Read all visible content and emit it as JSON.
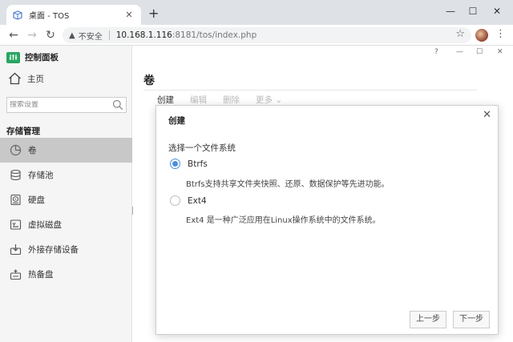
{
  "browser": {
    "tab_title": "桌面 - TOS",
    "tab_close": "✕",
    "new_tab": "+",
    "window_controls": {
      "minimize": "—",
      "maximize": "☐",
      "close": "✕"
    },
    "address": {
      "security_label": "不安全",
      "url_host": "10.168.1.116",
      "url_path": ":8181/tos/index.php"
    }
  },
  "sidebar": {
    "app_title": "控制面板",
    "home_label": "主页",
    "search_placeholder": "搜索设置",
    "section_title": "存储管理",
    "items": [
      {
        "label": "卷",
        "icon": "pie-chart-icon",
        "active": true
      },
      {
        "label": "存储池",
        "icon": "database-icon",
        "active": false
      },
      {
        "label": "硬盘",
        "icon": "hard-disk-icon",
        "active": false
      },
      {
        "label": "虚拟磁盘",
        "icon": "virtual-disk-icon",
        "active": false
      },
      {
        "label": "外接存储设备",
        "icon": "external-storage-icon",
        "active": false
      },
      {
        "label": "热备盘",
        "icon": "hot-spare-icon",
        "active": false
      }
    ]
  },
  "main": {
    "window_controls": {
      "help": "?",
      "minimize": "—",
      "maximize": "☐",
      "close": "✕"
    },
    "page_title": "卷",
    "toolbar": {
      "create": "创建",
      "edit": "编辑",
      "delete": "删除",
      "more": "更多"
    }
  },
  "modal": {
    "title": "创建",
    "close": "✕",
    "prompt": "选择一个文件系统",
    "options": [
      {
        "label": "Btrfs",
        "description": "Btrfs支持共享文件夹快照、还原、数据保护等先进功能。",
        "selected": true
      },
      {
        "label": "Ext4",
        "description": "Ext4 是一种广泛应用在Linux操作系统中的文件系统。",
        "selected": false
      }
    ],
    "prev_button": "上一步",
    "next_button": "下一步"
  },
  "colors": {
    "accent": "#4a90d9",
    "brand_green": "#2aa563",
    "sidebar_active": "#c8c8c8"
  }
}
